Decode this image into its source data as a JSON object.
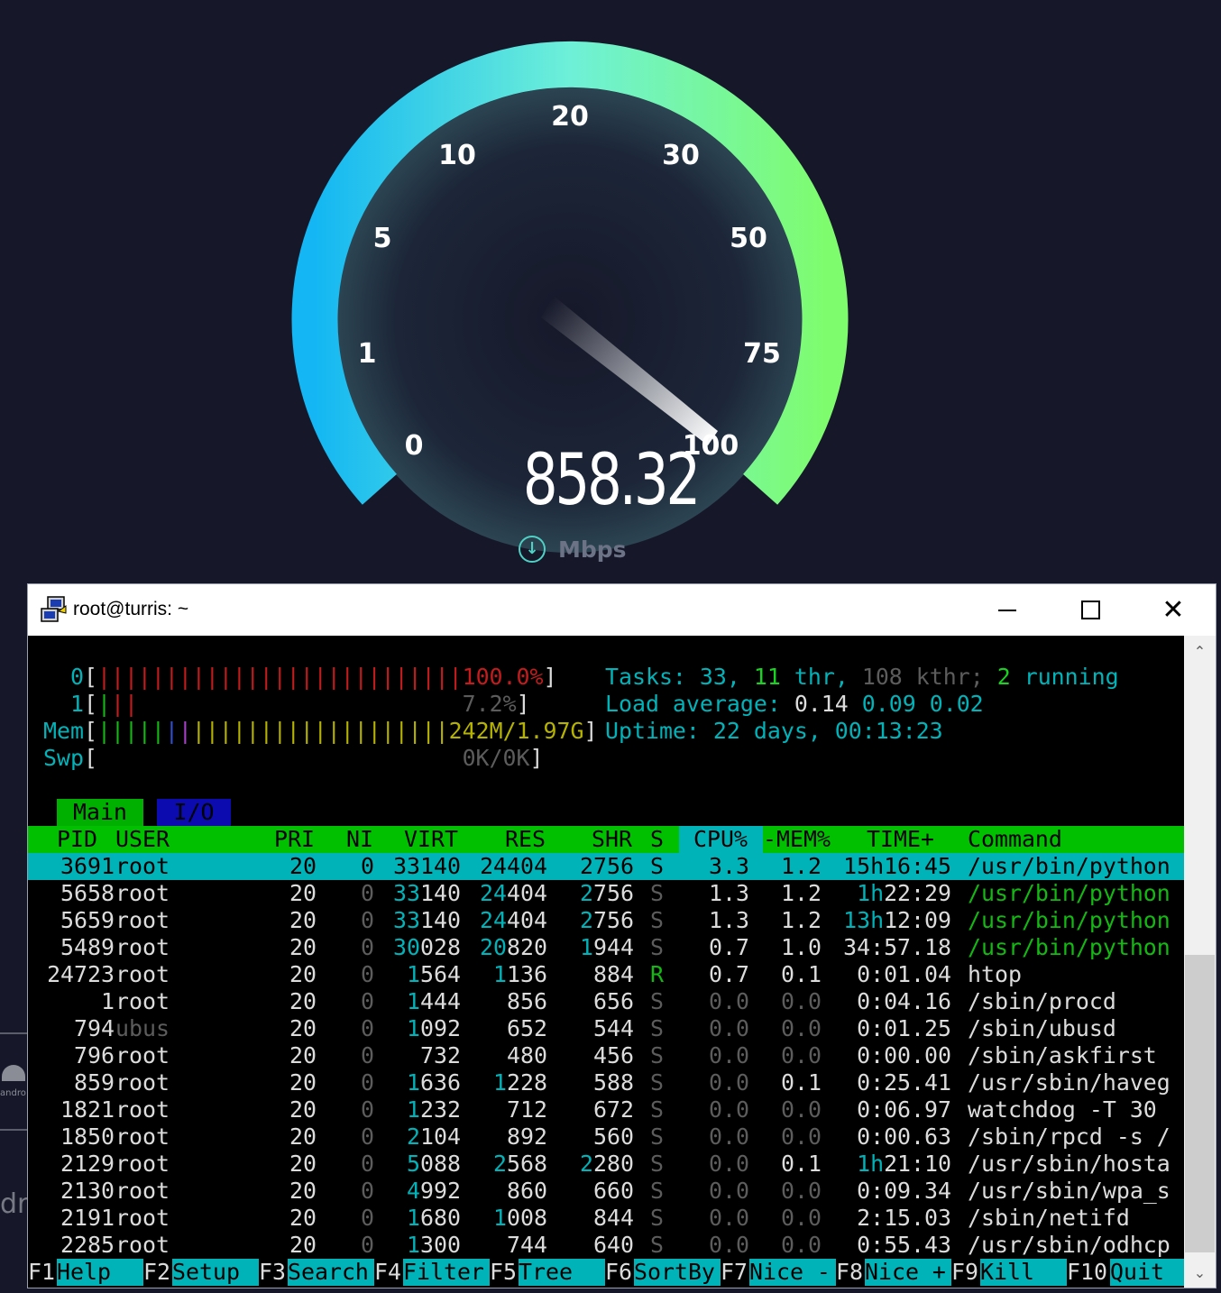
{
  "gauge": {
    "labels": [
      "0",
      "1",
      "5",
      "10",
      "20",
      "30",
      "50",
      "75",
      "100"
    ],
    "value": "858.32",
    "unit": "Mbps",
    "unit_icon": "download-arrow-icon",
    "gradient": [
      "#14b7f3",
      "#6ef0d8",
      "#7ffc6e"
    ]
  },
  "window": {
    "title": "root@turris: ~",
    "app_icon": "putty-icon"
  },
  "meters": {
    "cpu0": {
      "label": "0",
      "bars": "|||||||||||||||||||||||||||",
      "value": "100.0%"
    },
    "cpu1": {
      "label": "1",
      "bars": "|||",
      "value": "7.2%"
    },
    "mem": {
      "label": "Mem",
      "value": "242M/1.97G"
    },
    "swp": {
      "label": "Swp",
      "value": "0K/0K"
    }
  },
  "stats": {
    "tasks_label": "Tasks:",
    "tasks": "33,",
    "thr": "11",
    "thr_label": "thr,",
    "kthr": "108 kthr;",
    "running": "2",
    "running_label": "running",
    "load_label": "Load average:",
    "load1": "0.14",
    "load5": "0.09",
    "load15": "0.02",
    "uptime_label": "Uptime:",
    "uptime": "22 days, 00:13:23"
  },
  "tabs": {
    "main": "Main",
    "io": "I/O"
  },
  "header": {
    "pid": "PID",
    "user": "USER",
    "pri": "PRI",
    "ni": "NI",
    "virt": "VIRT",
    "res": "RES",
    "shr": "SHR",
    "s": "S",
    "cpu": "CPU%",
    "mem": "-MEM%",
    "time": "TIME+",
    "cmd": "Command"
  },
  "processes": [
    {
      "pid": "3691",
      "user": "root",
      "pri": "20",
      "ni": "0",
      "virt": "33140",
      "res": "24404",
      "shr": "2756",
      "s": "S",
      "cpu": "3.3",
      "mem": "1.2",
      "time": "15h16:45",
      "cmd": "/usr/bin/python"
    },
    {
      "pid": "5658",
      "user": "root",
      "pri": "20",
      "ni": "0",
      "virt": "33140",
      "res": "24404",
      "shr": "2756",
      "s": "S",
      "cpu": "1.3",
      "mem": "1.2",
      "time": "1h22:29",
      "cmd": "/usr/bin/python"
    },
    {
      "pid": "5659",
      "user": "root",
      "pri": "20",
      "ni": "0",
      "virt": "33140",
      "res": "24404",
      "shr": "2756",
      "s": "S",
      "cpu": "1.3",
      "mem": "1.2",
      "time": "13h12:09",
      "cmd": "/usr/bin/python"
    },
    {
      "pid": "5489",
      "user": "root",
      "pri": "20",
      "ni": "0",
      "virt": "30028",
      "res": "20820",
      "shr": "1944",
      "s": "S",
      "cpu": "0.7",
      "mem": "1.0",
      "time": "34:57.18",
      "cmd": "/usr/bin/python"
    },
    {
      "pid": "24723",
      "user": "root",
      "pri": "20",
      "ni": "0",
      "virt": "1564",
      "res": "1136",
      "shr": "884",
      "s": "R",
      "cpu": "0.7",
      "mem": "0.1",
      "time": "0:01.04",
      "cmd": "htop"
    },
    {
      "pid": "1",
      "user": "root",
      "pri": "20",
      "ni": "0",
      "virt": "1444",
      "res": "856",
      "shr": "656",
      "s": "S",
      "cpu": "0.0",
      "mem": "0.0",
      "time": "0:04.16",
      "cmd": "/sbin/procd"
    },
    {
      "pid": "794",
      "user": "ubus",
      "pri": "20",
      "ni": "0",
      "virt": "1092",
      "res": "652",
      "shr": "544",
      "s": "S",
      "cpu": "0.0",
      "mem": "0.0",
      "time": "0:01.25",
      "cmd": "/sbin/ubusd"
    },
    {
      "pid": "796",
      "user": "root",
      "pri": "20",
      "ni": "0",
      "virt": "732",
      "res": "480",
      "shr": "456",
      "s": "S",
      "cpu": "0.0",
      "mem": "0.0",
      "time": "0:00.00",
      "cmd": "/sbin/askfirst"
    },
    {
      "pid": "859",
      "user": "root",
      "pri": "20",
      "ni": "0",
      "virt": "1636",
      "res": "1228",
      "shr": "588",
      "s": "S",
      "cpu": "0.0",
      "mem": "0.1",
      "time": "0:25.41",
      "cmd": "/usr/sbin/haveg"
    },
    {
      "pid": "1821",
      "user": "root",
      "pri": "20",
      "ni": "0",
      "virt": "1232",
      "res": "712",
      "shr": "672",
      "s": "S",
      "cpu": "0.0",
      "mem": "0.0",
      "time": "0:06.97",
      "cmd": "watchdog -T 30"
    },
    {
      "pid": "1850",
      "user": "root",
      "pri": "20",
      "ni": "0",
      "virt": "2104",
      "res": "892",
      "shr": "560",
      "s": "S",
      "cpu": "0.0",
      "mem": "0.0",
      "time": "0:00.63",
      "cmd": "/sbin/rpcd -s /"
    },
    {
      "pid": "2129",
      "user": "root",
      "pri": "20",
      "ni": "0",
      "virt": "5088",
      "res": "2568",
      "shr": "2280",
      "s": "S",
      "cpu": "0.0",
      "mem": "0.1",
      "time": "1h21:10",
      "cmd": "/usr/sbin/hosta"
    },
    {
      "pid": "2130",
      "user": "root",
      "pri": "20",
      "ni": "0",
      "virt": "4992",
      "res": "860",
      "shr": "660",
      "s": "S",
      "cpu": "0.0",
      "mem": "0.0",
      "time": "0:09.34",
      "cmd": "/usr/sbin/wpa_s"
    },
    {
      "pid": "2191",
      "user": "root",
      "pri": "20",
      "ni": "0",
      "virt": "1680",
      "res": "1008",
      "shr": "844",
      "s": "S",
      "cpu": "0.0",
      "mem": "0.0",
      "time": "2:15.03",
      "cmd": "/sbin/netifd"
    },
    {
      "pid": "2285",
      "user": "root",
      "pri": "20",
      "ni": "0",
      "virt": "1300",
      "res": "744",
      "shr": "640",
      "s": "S",
      "cpu": "0.0",
      "mem": "0.0",
      "time": "0:55.43",
      "cmd": "/usr/sbin/odhcp"
    }
  ],
  "fkeys": [
    {
      "key": "F1",
      "label": "Help"
    },
    {
      "key": "F2",
      "label": "Setup"
    },
    {
      "key": "F3",
      "label": "Search"
    },
    {
      "key": "F4",
      "label": "Filter"
    },
    {
      "key": "F5",
      "label": "Tree"
    },
    {
      "key": "F6",
      "label": "SortBy"
    },
    {
      "key": "F7",
      "label": "Nice -"
    },
    {
      "key": "F8",
      "label": "Nice +"
    },
    {
      "key": "F9",
      "label": "Kill"
    },
    {
      "key": "F10",
      "label": "Quit"
    }
  ]
}
